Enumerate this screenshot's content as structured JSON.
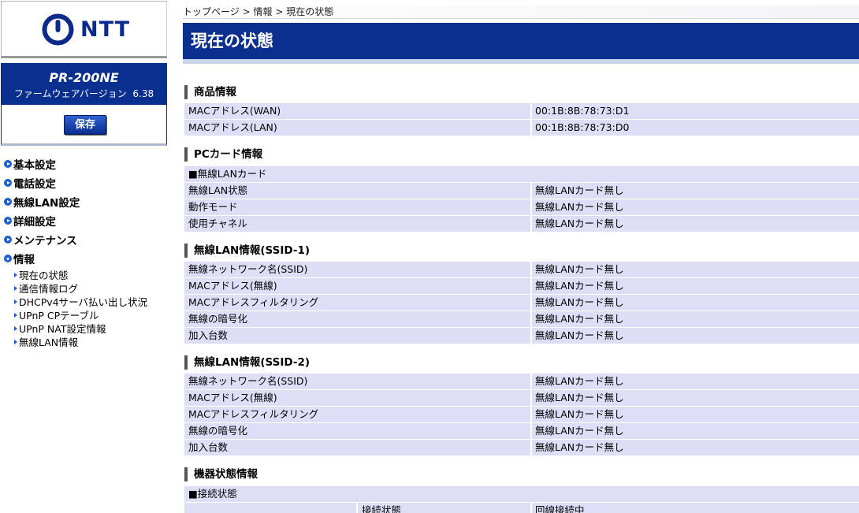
{
  "sidebar": {
    "logo_text": "NTT",
    "model": "PR-200NE",
    "firmware_label": "ファームウェアバージョン",
    "firmware_version": "6.38",
    "save_label": "保存",
    "menu": [
      {
        "label": "基本設定"
      },
      {
        "label": "電話設定"
      },
      {
        "label": "無線LAN設定"
      },
      {
        "label": "詳細設定"
      },
      {
        "label": "メンテナンス"
      },
      {
        "label": "情報"
      }
    ],
    "submenu": [
      {
        "label": "現在の状態"
      },
      {
        "label": "通信情報ログ"
      },
      {
        "label": "DHCPv4サーバ払い出し状況"
      },
      {
        "label": "UPnP CPテーブル"
      },
      {
        "label": "UPnP NAT設定情報"
      },
      {
        "label": "無線LAN情報"
      }
    ]
  },
  "breadcrumb": [
    "トップページ",
    ">",
    "情報",
    ">",
    "現在の状態"
  ],
  "page_title": "現在の状態",
  "sections": {
    "product": {
      "title": "商品情報",
      "rows": [
        {
          "key": "MACアドレス(WAN)",
          "value": "00:1B:8B:78:73:D1"
        },
        {
          "key": "MACアドレス(LAN)",
          "value": "00:1B:8B:78:73:D0"
        }
      ]
    },
    "pccard": {
      "title": "PCカード情報",
      "group": "■無線LANカード",
      "rows": [
        {
          "key": "無線LAN状態",
          "value": "無線LANカード無し"
        },
        {
          "key": "動作モード",
          "value": "無線LANカード無し"
        },
        {
          "key": "使用チャネル",
          "value": "無線LANカード無し"
        }
      ]
    },
    "ssid1": {
      "title": "無線LAN情報(SSID-1)",
      "rows": [
        {
          "key": "無線ネットワーク名(SSID)",
          "value": "無線LANカード無し"
        },
        {
          "key": "MACアドレス(無線)",
          "value": "無線LANカード無し"
        },
        {
          "key": "MACアドレスフィルタリング",
          "value": "無線LANカード無し"
        },
        {
          "key": "無線の暗号化",
          "value": "無線LANカード無し"
        },
        {
          "key": "加入台数",
          "value": "無線LANカード無し"
        }
      ]
    },
    "ssid2": {
      "title": "無線LAN情報(SSID-2)",
      "rows": [
        {
          "key": "無線ネットワーク名(SSID)",
          "value": "無線LANカード無し"
        },
        {
          "key": "MACアドレス(無線)",
          "value": "無線LANカード無し"
        },
        {
          "key": "MACアドレスフィルタリング",
          "value": "無線LANカード無し"
        },
        {
          "key": "無線の暗号化",
          "value": "無線LANカード無し"
        },
        {
          "key": "加入台数",
          "value": "無線LANカード無し"
        }
      ]
    },
    "device": {
      "title": "機器状態情報",
      "group": "■接続状態",
      "conn_key": "接続状態",
      "conn_value": "回線接続中"
    }
  },
  "colors": {
    "brand_blue": "#0a2f8f",
    "row_bg": "#dedff7"
  }
}
